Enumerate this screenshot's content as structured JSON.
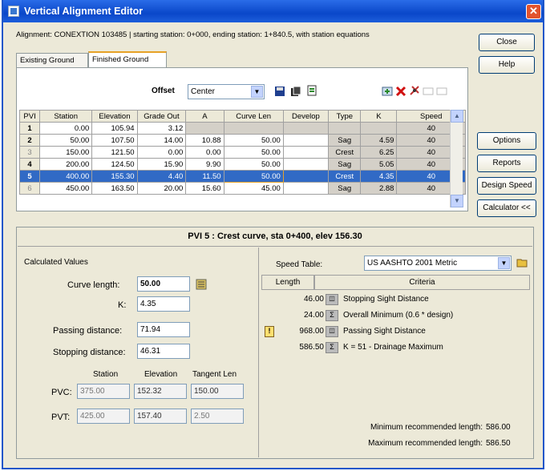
{
  "title": "Vertical Alignment Editor",
  "info_line": "Alignment: CONEXTION 103485 | starting station: 0+000, ending station: 1+840.5, with station equations",
  "side_buttons": {
    "close": "Close",
    "help": "Help",
    "options": "Options",
    "reports": "Reports",
    "design_speed": "Design Speed",
    "calculator": "Calculator <<"
  },
  "tabs": [
    "Existing Ground",
    "Finished Ground"
  ],
  "offset": {
    "label": "Offset",
    "value": "Center"
  },
  "grid": {
    "headers": [
      "PVI",
      "Station",
      "Elevation",
      "Grade Out",
      "A",
      "Curve Len",
      "Develop",
      "Type",
      "K",
      "Speed"
    ],
    "rows": [
      [
        "1",
        "0.00",
        "105.94",
        "3.12",
        "",
        "",
        "",
        "",
        "",
        "40"
      ],
      [
        "2",
        "50.00",
        "107.50",
        "14.00",
        "10.88",
        "50.00",
        "",
        "Sag",
        "4.59",
        "40"
      ],
      [
        "3",
        "150.00",
        "121.50",
        "0.00",
        "0.00",
        "50.00",
        "",
        "Crest",
        "6.25",
        "40"
      ],
      [
        "4",
        "200.00",
        "124.50",
        "15.90",
        "9.90",
        "50.00",
        "",
        "Sag",
        "5.05",
        "40"
      ],
      [
        "5",
        "400.00",
        "155.30",
        "4.40",
        "11.50",
        "50.00",
        "",
        "Crest",
        "4.35",
        "40"
      ],
      [
        "6",
        "450.00",
        "163.50",
        "20.00",
        "15.60",
        "45.00",
        "",
        "Sag",
        "2.88",
        "40"
      ]
    ]
  },
  "pvi_header": "PVI 5 :  Crest curve,  sta 0+400,  elev 156.30",
  "calc": {
    "title": "Calculated Values",
    "curve_length_label": "Curve length:",
    "curve_length": "50.00",
    "k_label": "K:",
    "k": "4.35",
    "passing_label": "Passing distance:",
    "passing": "71.94",
    "stopping_label": "Stopping distance:",
    "stopping": "46.31",
    "col_station": "Station",
    "col_elevation": "Elevation",
    "col_tangent": "Tangent Len",
    "pvc_label": "PVC:",
    "pvc_station": "375.00",
    "pvc_elevation": "152.32",
    "pvc_tangent": "150.00",
    "pvt_label": "PVT:",
    "pvt_station": "425.00",
    "pvt_elevation": "157.40",
    "pvt_tangent": "2.50"
  },
  "speed_table": {
    "label": "Speed Table:",
    "value": "US AASHTO 2001 Metric",
    "col_length": "Length",
    "col_criteria": "Criteria",
    "rows": [
      {
        "length": "46.00",
        "criteria": "Stopping Sight Distance"
      },
      {
        "length": "24.00",
        "criteria": "Overall Minimum (0.6 * design)"
      },
      {
        "length": "968.00",
        "criteria": "Passing Sight Distance"
      },
      {
        "length": "586.50",
        "criteria": "K = 51 - Drainage Maximum"
      }
    ],
    "min_label": "Minimum recommended length:",
    "min_value": "586.00",
    "max_label": "Maximum recommended length:",
    "max_value": "586.50"
  }
}
